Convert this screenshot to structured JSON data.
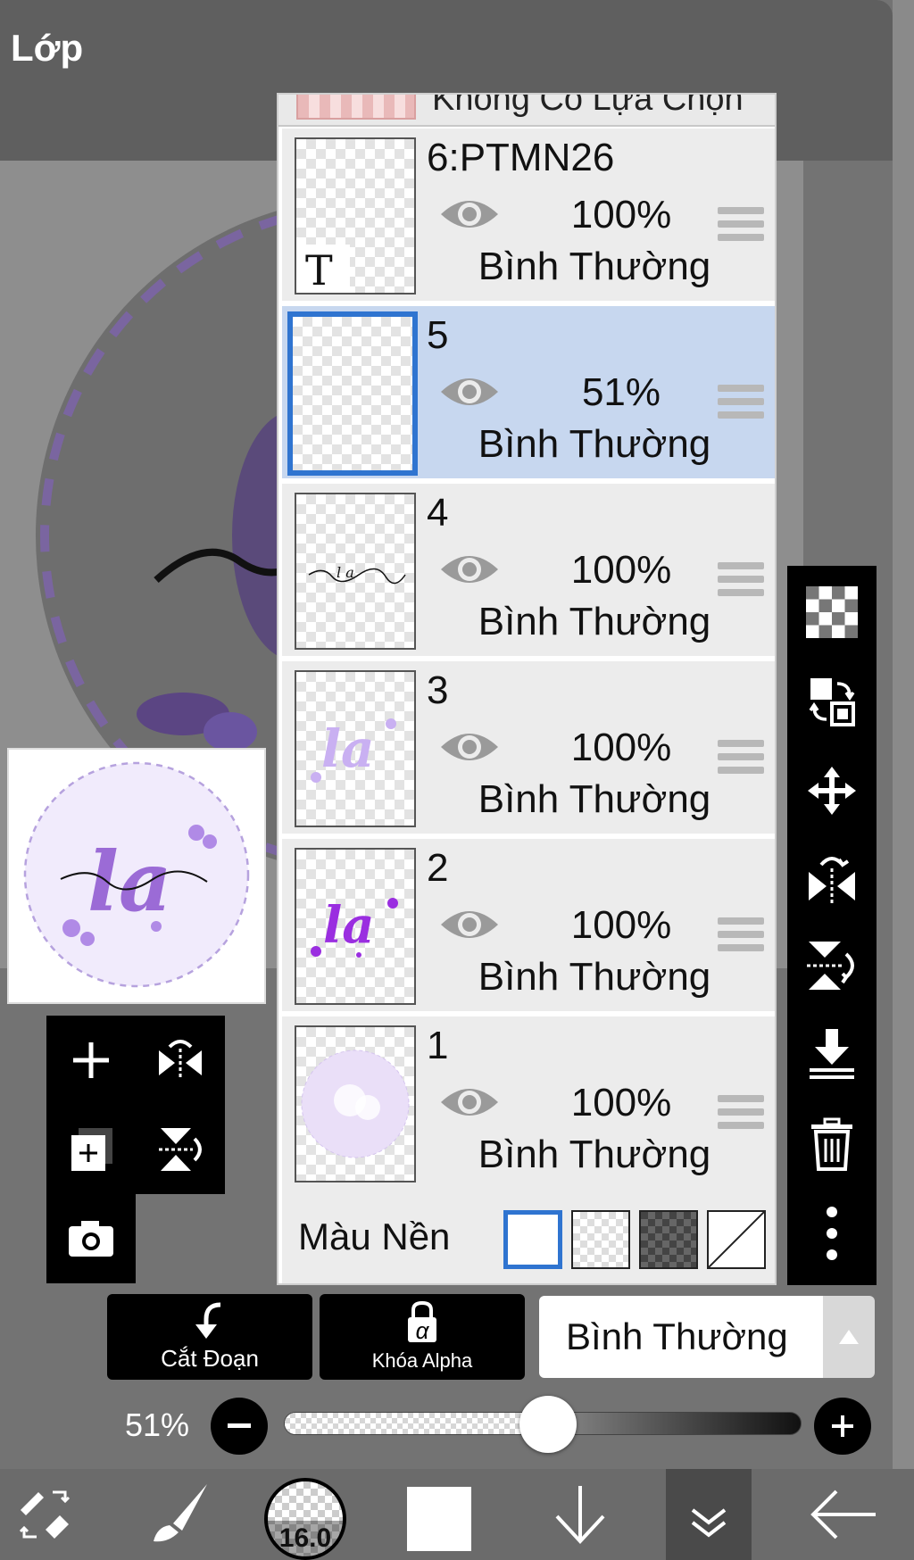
{
  "header": {
    "title": "Lớp"
  },
  "layers": {
    "partial_row_label": "Không Có Lựa Chọn",
    "items": [
      {
        "name": "6:PTMN26",
        "opacity": "100%",
        "blend": "Bình Thường",
        "thumb": "text-layer",
        "thumb_glyph": "T",
        "selected": false
      },
      {
        "name": "5",
        "opacity": "51%",
        "blend": "Bình Thường",
        "thumb": "empty",
        "selected": true
      },
      {
        "name": "4",
        "opacity": "100%",
        "blend": "Bình Thường",
        "thumb": "signature-line",
        "selected": false
      },
      {
        "name": "3",
        "opacity": "100%",
        "blend": "Bình Thường",
        "thumb": "light-purple-la",
        "selected": false
      },
      {
        "name": "2",
        "opacity": "100%",
        "blend": "Bình Thường",
        "thumb": "purple-la",
        "selected": false
      },
      {
        "name": "1",
        "opacity": "100%",
        "blend": "Bình Thường",
        "thumb": "circle-background",
        "selected": false
      }
    ],
    "background": {
      "label": "Màu Nền",
      "options": [
        "white",
        "checker-light",
        "checker-dark",
        "none"
      ],
      "selected": "white"
    }
  },
  "bottom_controls": {
    "clipping_label": "Cắt Đoạn",
    "alpha_lock_label": "Khóa Alpha",
    "alpha_glyph": "α",
    "blend_mode": "Bình Thường"
  },
  "opacity_slider": {
    "label": "51%",
    "value": 0.51
  },
  "toolbar": {
    "brush_size": "16.0",
    "current_color": "#ffffff"
  },
  "icons": {
    "right": [
      "transparency-icon",
      "layer-swap-icon",
      "move-icon",
      "flip-horizontal-icon",
      "flip-vertical-icon",
      "merge-down-icon",
      "trash-icon",
      "more-icon"
    ],
    "left": [
      "add-layer-icon",
      "flip-h-small-icon",
      "copy-layer-icon",
      "flip-v-small-icon",
      "camera-icon"
    ]
  },
  "colors": {
    "accent_blue": "#2f74d0",
    "selected_row": "#c7d7ef",
    "purple": "#9b6bd6"
  }
}
